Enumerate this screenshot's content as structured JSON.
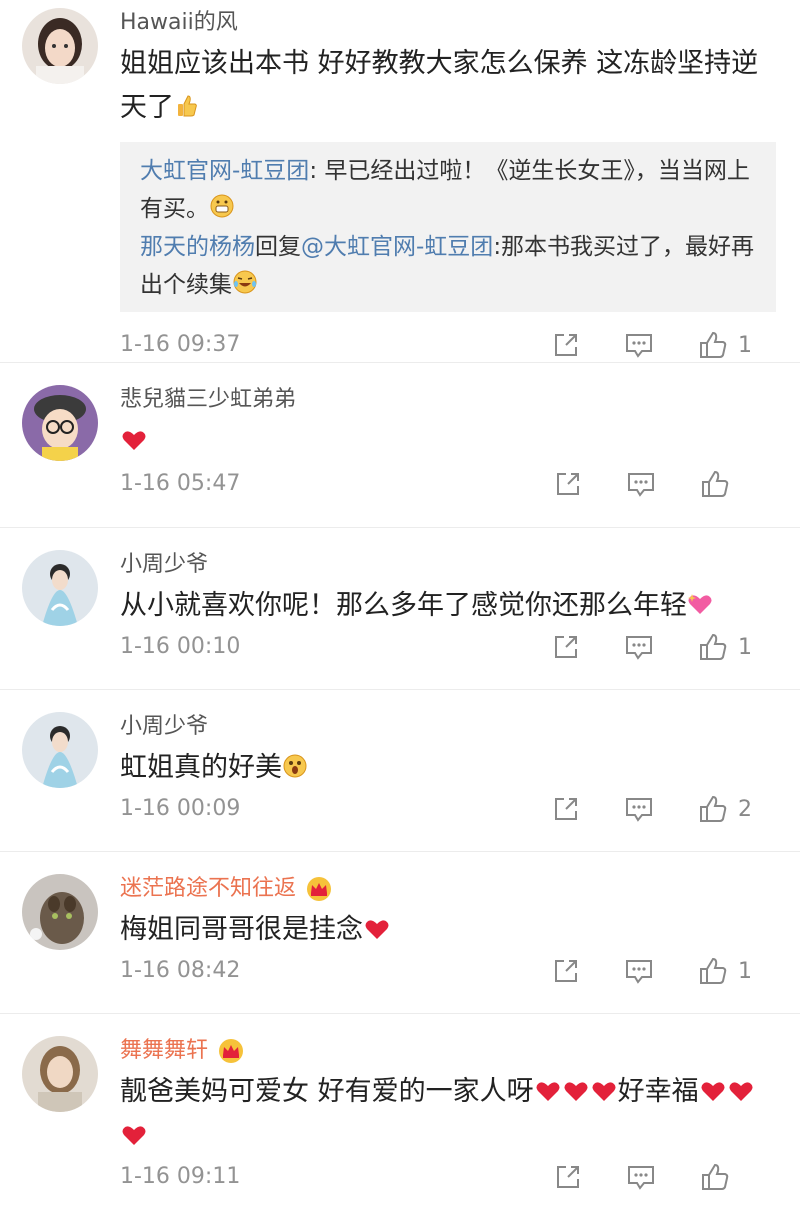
{
  "colors": {
    "link": "#507daf",
    "vip_name": "#eb7350",
    "heart": "#e3213a",
    "meta": "#939393"
  },
  "comments": [
    {
      "user": "Hawaii的风",
      "text": "姐姐应该出本书 好好教教大家怎么保养 这冻龄坚持逆天了",
      "replies": [
        {
          "who": "大虹官网-虹豆团",
          "text": ": 早已经出过啦！《逆生长女王》，当当网上有买。"
        },
        {
          "who": "那天的杨杨",
          "mid": "回复",
          "who2": "@大虹官网-虹豆团",
          "text": ":那本书我买过了，最好再出个续集"
        }
      ],
      "time": "1-16 09:37",
      "likes": "1"
    },
    {
      "user": "悲兒貓三少虹弟弟",
      "text": "",
      "time": "1-16 05:47",
      "likes": ""
    },
    {
      "user": "小周少爷",
      "text": "从小就喜欢你呢！那么多年了感觉你还那么年轻",
      "time": "1-16 00:10",
      "likes": "1"
    },
    {
      "user": "小周少爷",
      "text": "虹姐真的好美",
      "time": "1-16 00:09",
      "likes": "2"
    },
    {
      "user": "迷茫路途不知往返",
      "text": "梅姐同哥哥很是挂念",
      "time": "1-16 08:42",
      "likes": "1"
    },
    {
      "user": "舞舞舞轩",
      "text": "靓爸美妈可爱女 好有爱的一家人呀",
      "text2": "好幸福",
      "time": "1-16 09:11",
      "likes": ""
    }
  ]
}
